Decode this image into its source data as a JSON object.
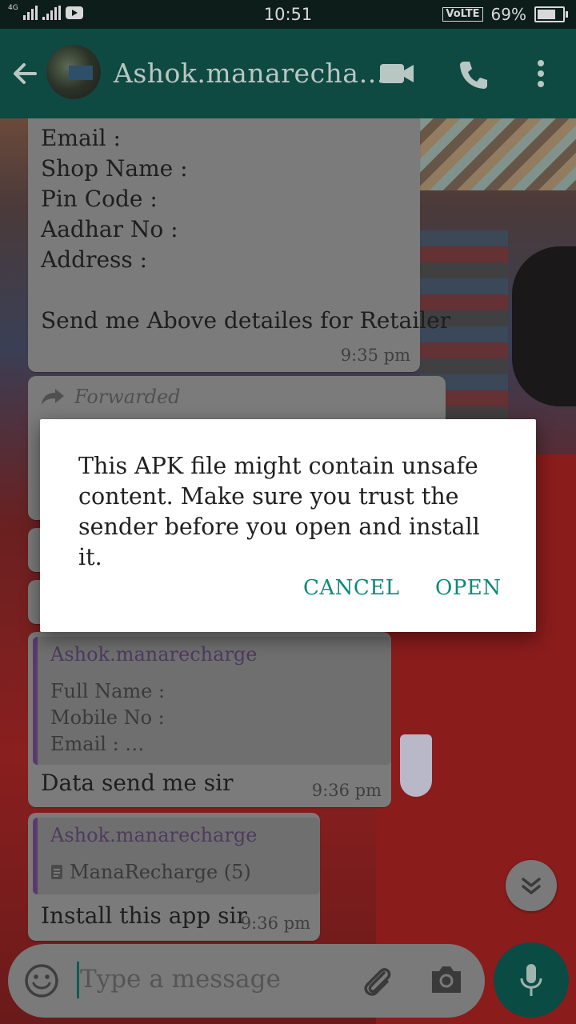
{
  "status_bar": {
    "network": "4G",
    "time": "10:51",
    "volte": "VoLTE",
    "battery": "69%"
  },
  "header": {
    "contact_name": "Ashok.manarecha…"
  },
  "messages": {
    "form_lines": [
      "Email :",
      "Shop Name :",
      "Pin Code :",
      "Aadhar No :",
      "Address :"
    ],
    "form_request": "Send me Above detailes for Retailer",
    "form_time": "9:35 pm",
    "forwarded_label": "Forwarded",
    "reply1": {
      "quote_author": "Ashok.manarecharge",
      "quote_lines": [
        "Full Name :",
        "Mobile No :",
        "Email : …"
      ],
      "text": "Data send me sir",
      "time": "9:36 pm"
    },
    "reply2": {
      "quote_author": "Ashok.manarecharge",
      "quote_file": "ManaRecharge (5)",
      "text": "Install this app sir",
      "time": "9:36 pm"
    }
  },
  "input": {
    "placeholder": "Type a message"
  },
  "dialog": {
    "message": "This APK file might contain unsafe content. Make sure you trust the sender before you open and install it.",
    "cancel_label": "CANCEL",
    "open_label": "OPEN"
  },
  "colors": {
    "accent": "#0e8a78",
    "header": "#0f4a42",
    "quote_author": "#4e3a5e"
  }
}
